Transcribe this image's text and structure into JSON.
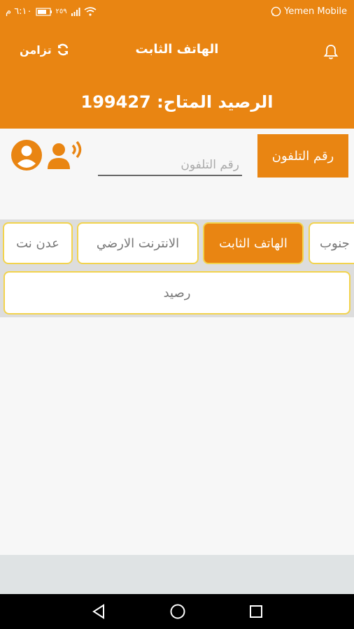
{
  "status_bar": {
    "carrier": "Yemen Mobile",
    "time": "٦:١٠ م",
    "data_speed": "٢٥٩"
  },
  "app_bar": {
    "title": "الهاتف الثابت",
    "sync_label": "تزامن",
    "balance_label": "الرصيد المتاح:",
    "balance_value": "199427"
  },
  "phone": {
    "button_label": "رقم التلفون",
    "placeholder": "رقم التلفون"
  },
  "tabs": [
    {
      "label": "جنوب"
    },
    {
      "label": "الهاتف الثابت",
      "active": true
    },
    {
      "label": "الانترنت الارضي"
    },
    {
      "label": "عدن نت"
    }
  ],
  "balance_tab": {
    "label": "رصيد"
  },
  "colors": {
    "primary": "#e98512",
    "tab_border": "#f2d34d"
  }
}
